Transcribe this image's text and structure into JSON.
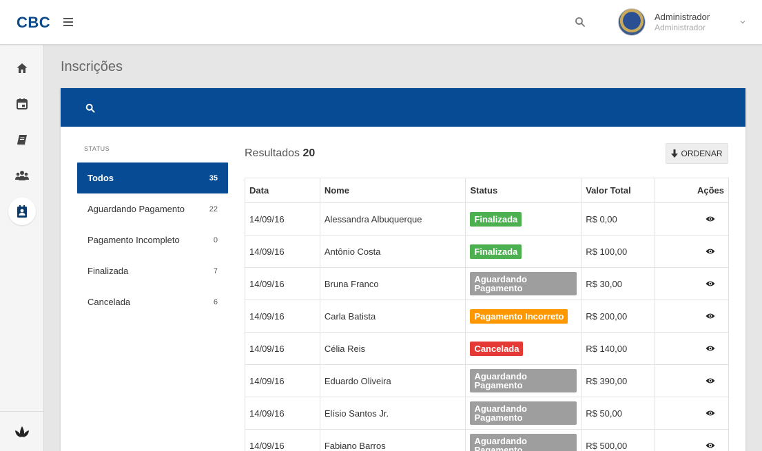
{
  "header": {
    "logo": "CBC",
    "user_name": "Administrador",
    "user_role": "Administrador"
  },
  "page": {
    "title": "Inscrições"
  },
  "filters": {
    "label": "STATUS",
    "items": [
      {
        "label": "Todos",
        "count": "35"
      },
      {
        "label": "Aguardando Pagamento",
        "count": "22"
      },
      {
        "label": "Pagamento Incompleto",
        "count": "0"
      },
      {
        "label": "Finalizada",
        "count": "7"
      },
      {
        "label": "Cancelada",
        "count": "6"
      }
    ]
  },
  "results": {
    "label": "Resultados",
    "count": "20"
  },
  "order_button": {
    "label": "ORDENAR"
  },
  "table": {
    "columns": [
      "Data",
      "Nome",
      "Status",
      "Valor Total",
      "Ações"
    ],
    "rows": [
      {
        "date": "14/09/16",
        "name": "Alessandra Albuquerque",
        "status": "Finalizada",
        "status_color": "#4caf50",
        "value": "R$ 0,00"
      },
      {
        "date": "14/09/16",
        "name": "Antônio Costa",
        "status": "Finalizada",
        "status_color": "#4caf50",
        "value": "R$ 100,00"
      },
      {
        "date": "14/09/16",
        "name": "Bruna Franco",
        "status": "Aguardando Pagamento",
        "status_color": "#9e9e9e",
        "value": "R$ 30,00"
      },
      {
        "date": "14/09/16",
        "name": "Carla Batista",
        "status": "Pagamento Incorreto",
        "status_color": "#ff9800",
        "value": "R$ 200,00"
      },
      {
        "date": "14/09/16",
        "name": "Célia Reis",
        "status": "Cancelada",
        "status_color": "#e53935",
        "value": "R$ 140,00"
      },
      {
        "date": "14/09/16",
        "name": "Eduardo Oliveira",
        "status": "Aguardando Pagamento",
        "status_color": "#9e9e9e",
        "value": "R$ 390,00"
      },
      {
        "date": "14/09/16",
        "name": "Elísio Santos Jr.",
        "status": "Aguardando Pagamento",
        "status_color": "#9e9e9e",
        "value": "R$ 50,00"
      },
      {
        "date": "14/09/16",
        "name": "Fabiano Barros",
        "status": "Aguardando Pagamento",
        "status_color": "#9e9e9e",
        "value": "R$ 500,00"
      }
    ]
  },
  "colors": {
    "brand": "#064b94",
    "sidebar_bg": "#f5f5f5"
  },
  "icons": {
    "sidebar": [
      "home-icon",
      "calendar-icon",
      "book-icon",
      "group-icon",
      "contact-card-icon"
    ],
    "sidebar_bottom": "leaf-logo-icon"
  }
}
